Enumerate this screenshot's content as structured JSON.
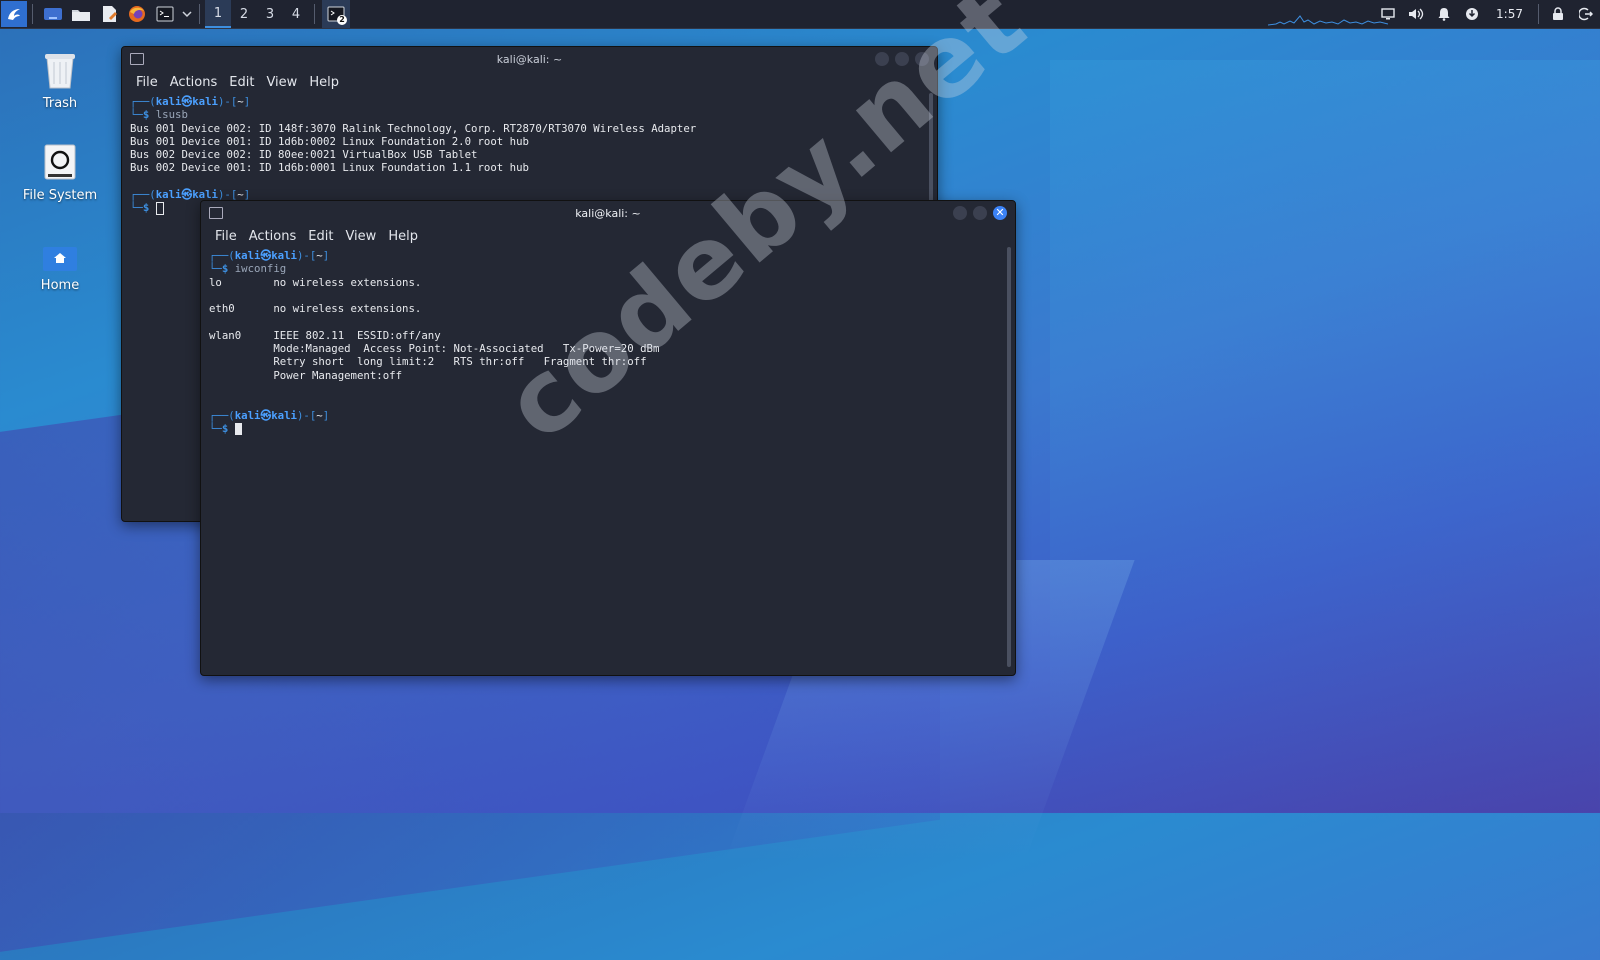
{
  "colors": {
    "accent": "#3d8fe0",
    "terminal_bg": "#242834",
    "taskbar_bg": "#1f2330"
  },
  "taskbar": {
    "launchers": [
      "kali-menu-icon",
      "desktop-icon",
      "file-manager-icon",
      "text-editor-icon",
      "firefox-icon",
      "terminal-icon",
      "chevron-down-icon"
    ],
    "workspaces": [
      "1",
      "2",
      "3",
      "4"
    ],
    "active_workspace": "1",
    "task_badge": "2",
    "clock": "1:57",
    "tray_icons": [
      "display-icon",
      "volume-icon",
      "bell-icon",
      "update-icon",
      "lock-icon",
      "logout-icon"
    ]
  },
  "desktop": {
    "icons": [
      {
        "label": "Trash",
        "icon": "trash-icon"
      },
      {
        "label": "File System",
        "icon": "drive-icon"
      },
      {
        "label": "Home",
        "icon": "home-folder-icon"
      }
    ]
  },
  "term_back": {
    "title": "kali@kali: ~",
    "menu": [
      "File",
      "Actions",
      "Edit",
      "View",
      "Help"
    ],
    "prompt_user": "kali",
    "prompt_at": "㉿",
    "prompt_host": "kali",
    "prompt_dir": "~",
    "command": "lsusb",
    "output": [
      "Bus 001 Device 002: ID 148f:3070 Ralink Technology, Corp. RT2870/RT3070 Wireless Adapter",
      "Bus 001 Device 001: ID 1d6b:0002 Linux Foundation 2.0 root hub",
      "Bus 002 Device 002: ID 80ee:0021 VirtualBox USB Tablet",
      "Bus 002 Device 001: ID 1d6b:0001 Linux Foundation 1.1 root hub"
    ]
  },
  "term_front": {
    "title": "kali@kali: ~",
    "menu": [
      "File",
      "Actions",
      "Edit",
      "View",
      "Help"
    ],
    "prompt_user": "kali",
    "prompt_at": "㉿",
    "prompt_host": "kali",
    "prompt_dir": "~",
    "command": "iwconfig",
    "output": [
      "lo        no wireless extensions.",
      "",
      "eth0      no wireless extensions.",
      "",
      "wlan0     IEEE 802.11  ESSID:off/any",
      "          Mode:Managed  Access Point: Not-Associated   Tx-Power=20 dBm",
      "          Retry short  long limit:2   RTS thr:off   Fragment thr:off",
      "          Power Management:off",
      "",
      ""
    ]
  },
  "watermark": "codeby.net"
}
